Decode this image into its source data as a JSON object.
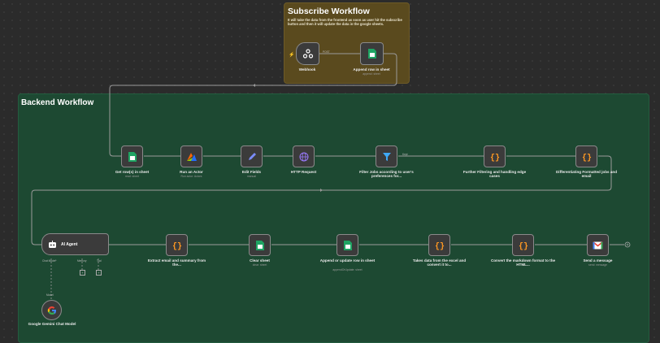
{
  "subscribe": {
    "title": "Subscribe Workflow",
    "description": "It will take the data from the frontend as soon as user hit the subscribe button and then it will update the data in the google sheets.",
    "webhook": {
      "label": "Webhook",
      "port": "POST"
    },
    "append": {
      "label": "Append row in sheet",
      "sub": "append: sheet"
    }
  },
  "backend": {
    "title": "Backend Workflow",
    "row1": [
      {
        "label": "Get row(s) in sheet",
        "sub": "read: sheet",
        "icon": "sheets-icon"
      },
      {
        "label": "Run an Actor",
        "sub": "Run actor: Actors",
        "icon": "apify-icon"
      },
      {
        "label": "Edit Fields",
        "sub": "manual",
        "icon": "pencil-icon"
      },
      {
        "label": "HTTP Request",
        "sub": "",
        "icon": "globe-icon"
      },
      {
        "label": "Filter Jobs according to user's preferences for...",
        "sub": "",
        "icon": "filter-icon",
        "port": "Kept"
      },
      {
        "label": "Further Filtering and handling edge cases",
        "sub": "",
        "icon": "code-icon"
      },
      {
        "label": "Differentiating Formatted jobs and email",
        "sub": "",
        "icon": "code-icon"
      }
    ],
    "agent": {
      "label": "AI Agent",
      "chat": "Chat Model*",
      "memory": "Memory",
      "tool": "Tool"
    },
    "row2": [
      {
        "label": "Extract email and summary from the...",
        "sub": "",
        "icon": "code-icon"
      },
      {
        "label": "Clear sheet",
        "sub": "clear: sheet",
        "icon": "sheets-icon"
      },
      {
        "label": "Append or update row in sheet",
        "sub": "appendOrUpdate: sheet",
        "icon": "sheets-icon"
      },
      {
        "label": "Takes data from the excel and convert it to...",
        "sub": "",
        "icon": "code-icon"
      },
      {
        "label": "Convert the markdown format to the HTML...",
        "sub": "",
        "icon": "code-icon"
      },
      {
        "label": "Send a message",
        "sub": "send: message",
        "icon": "gmail-icon"
      }
    ],
    "gemini": {
      "label": "Google Gemini Chat Model",
      "port": "Model"
    }
  }
}
